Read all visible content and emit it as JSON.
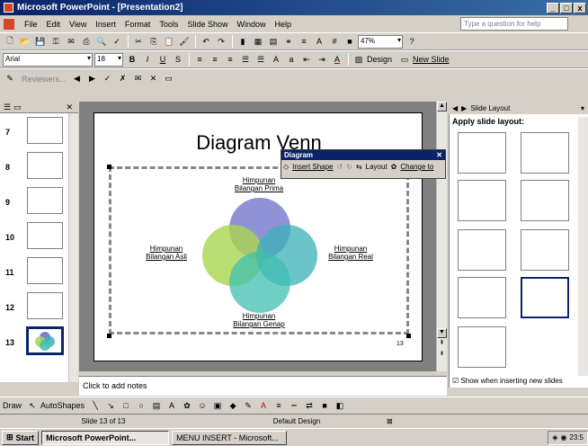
{
  "window": {
    "title": "Microsoft PowerPoint - [Presentation2]",
    "ctrl_min": "_",
    "ctrl_max": "□",
    "ctrl_close": "x"
  },
  "menus": [
    {
      "label": "File"
    },
    {
      "label": "Edit"
    },
    {
      "label": "View"
    },
    {
      "label": "Insert"
    },
    {
      "label": "Format"
    },
    {
      "label": "Tools"
    },
    {
      "label": "Slide Show"
    },
    {
      "label": "Window"
    },
    {
      "label": "Help"
    }
  ],
  "ask": {
    "placeholder": "Type a question for help"
  },
  "toolbar": {
    "zoom": "47%",
    "font": "Arial",
    "size": "18",
    "design_label": "Design",
    "new_slide_label": "New Slide",
    "reviewers_label": "Reviewers..."
  },
  "thumbnails": [
    {
      "num": "7"
    },
    {
      "num": "8"
    },
    {
      "num": "9"
    },
    {
      "num": "10"
    },
    {
      "num": "11"
    },
    {
      "num": "12"
    },
    {
      "num": "13"
    }
  ],
  "slide": {
    "title": "Diagram Venn",
    "label_top1": "Himpunan",
    "label_top2": "Bilangan Prima",
    "label_left1": "Himpunan",
    "label_left2": "Bilangan Asli",
    "label_right1": "Himpunan",
    "label_right2": "Bilangan Real",
    "label_bottom1": "Himpunan",
    "label_bottom2": "Bilangan Genap",
    "page_num": "13",
    "colors": {
      "top": "#7b7fd0",
      "left": "#a9d64f",
      "right": "#3ab0b8",
      "bottom": "#3fbfb0"
    }
  },
  "diagram_toolbar": {
    "title": "Diagram",
    "insert_shape": "Insert Shape",
    "layout": "Layout",
    "change_to": "Change to"
  },
  "notes": {
    "placeholder": "Click to add notes"
  },
  "taskpane": {
    "title": "Slide Layout",
    "subtitle": "Apply slide layout:",
    "show_checkbox": "Show when inserting new slides"
  },
  "drawbar": {
    "draw": "Draw",
    "autoshapes": "AutoShapes"
  },
  "status": {
    "slide": "Slide 13 of 13",
    "design": "Default Design"
  },
  "taskbar": {
    "start": "Start",
    "app1": "Microsoft PowerPoint...",
    "app2": "MENU INSERT - Microsoft...",
    "clock": "23:5"
  }
}
